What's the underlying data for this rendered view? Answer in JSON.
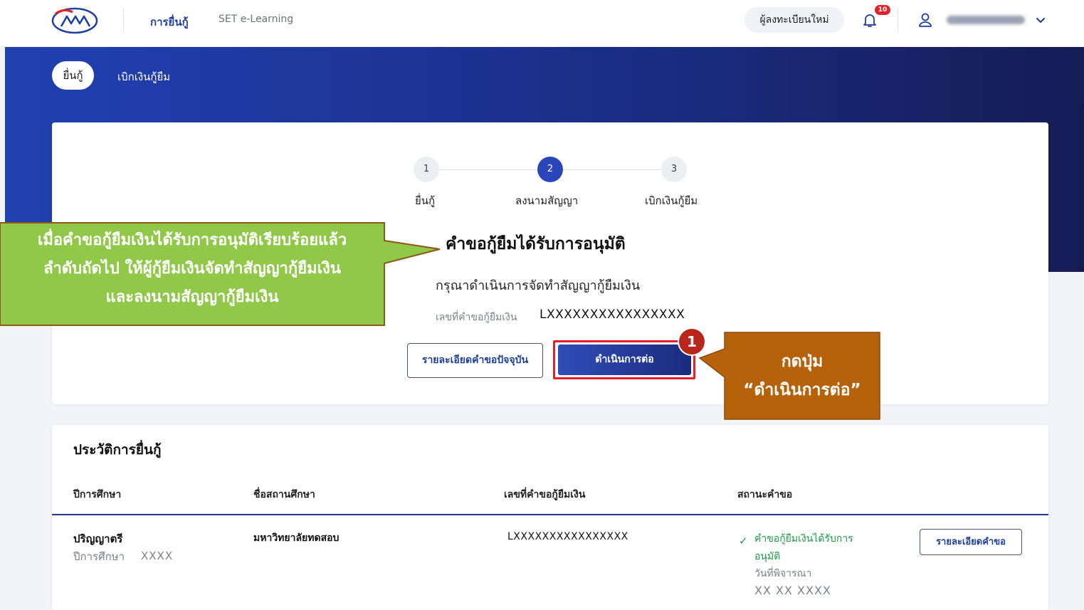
{
  "nav": {
    "links": [
      "การยื่นกู้",
      "SET e-Learning"
    ],
    "register_label": "ผู้ลงทะเบียนใหม่",
    "notification_count": "10",
    "brand_color": "#1f3f9e"
  },
  "subtabs": [
    "ยื่นกู้",
    "เบิกเงินกู้ยืม"
  ],
  "steps": [
    {
      "number": "1",
      "label": "ยื่นกู้",
      "active": false
    },
    {
      "number": "2",
      "label": "ลงนามสัญญา",
      "active": true
    },
    {
      "number": "3",
      "label": "เบิกเงินกู้ยืม",
      "active": false
    }
  ],
  "card": {
    "title": "คำขอกู้ยืมได้รับการอนุมัติ",
    "subtitle": "กรุณาดำเนินการจัดทำสัญญากู้ยืมเงิน",
    "ref_label": "เลขที่คำขอกู้ยืมเงิน",
    "ref_value": "LXXXXXXXXXXXXXXXX",
    "details_button": "รายละเอียดคำขอปัจจุบัน",
    "continue_button": "ดำเนินการต่อ"
  },
  "annotations": {
    "step_number": "1",
    "green_callout": [
      "เมื่อคำขอกู้ยืมเงินได้รับการอนุมัติเรียบร้อยแล้ว",
      "ลำดับถัดไป ให้ผู้กู้ยืมเงินจัดทำสัญญากู้ยืมเงิน",
      "และลงนามสัญญากู้ยืมเงิน"
    ],
    "orange_callout": [
      "กดปุ่ม",
      "“ดำเนินการต่อ”"
    ],
    "green_color": "#92c84a",
    "orange_color": "#b5620b",
    "highlight_color": "#e5202a"
  },
  "history": {
    "title": "ประวัติการยื่นกู้",
    "columns": [
      "ปีการศึกษา",
      "ชื่อสถานศึกษา",
      "เลขที่คำขอกู้ยืมเงิน",
      "สถานะคำขอ"
    ],
    "rows": [
      {
        "degree": "ปริญญาตรี",
        "year_label": "ปีการศึกษา",
        "year_value": "XXXX",
        "school": "มหาวิทยาลัยทดสอบ",
        "ref": "LXXXXXXXXXXXXXXXX",
        "status_lines": [
          "คำขอกู้ยืมเงินได้รับการ",
          "อนุมัติ"
        ],
        "date_label": "วันที่พิจารณา",
        "date_value": "XX XX XXXX",
        "details_button": "รายละเอียดคำขอ"
      }
    ]
  }
}
